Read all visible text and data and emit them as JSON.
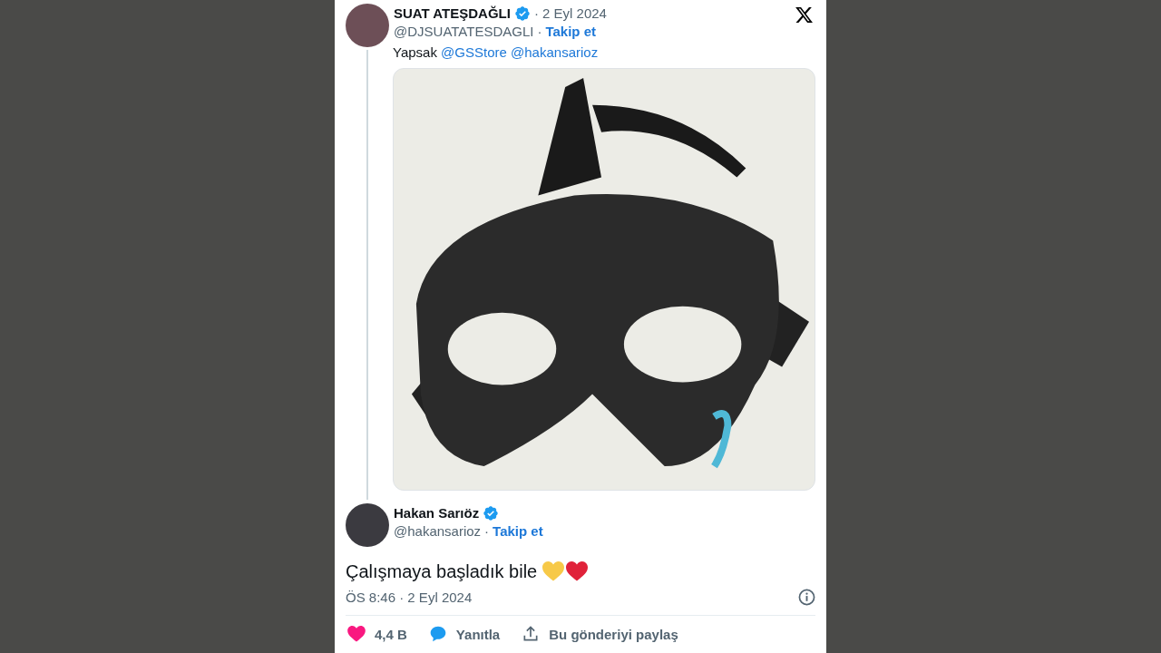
{
  "parent_tweet": {
    "author": "SUAT ATEŞDAĞLI",
    "verified": true,
    "date": "· 2 Eyl 2024",
    "handle": "@DJSUATATESDAGLI",
    "separator": "·",
    "follow": "Takip et",
    "text": [
      {
        "kind": "plain",
        "text": "Yapsak"
      },
      {
        "kind": "mention",
        "text": "@GSStore"
      },
      {
        "kind": "mention",
        "text": "@hakansarioz"
      }
    ]
  },
  "tweet": {
    "author": "Hakan Sarıöz",
    "verified": true,
    "handle": "@hakansarioz",
    "separator": "·",
    "follow": "Takip et",
    "text": "Çalışmaya başladık bile",
    "emoji": [
      {
        "kind": "heart",
        "color": "#f7c948"
      },
      {
        "kind": "heart",
        "color": "#e0223a"
      }
    ],
    "timestamp": "ÖS 8:46 · 2 Eyl 2024"
  },
  "actions": [
    {
      "kind": "like",
      "label": "4,4 B"
    },
    {
      "kind": "reply",
      "label": "Yanıtla"
    },
    {
      "kind": "share",
      "label": "Bu gönderiyi paylaş"
    }
  ]
}
